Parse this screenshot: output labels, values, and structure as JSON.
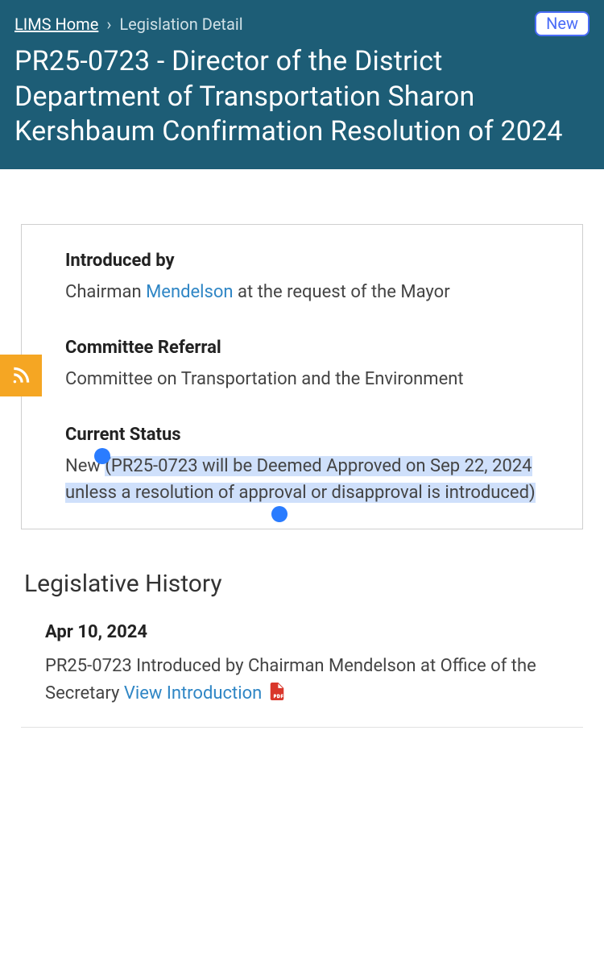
{
  "header": {
    "breadcrumb_home": "LIMS Home",
    "breadcrumb_current": "Legislation Detail",
    "new_badge": "New",
    "title": "PR25-0723 - Director of the District Department of Transportation Sharon Kershbaum Confirmation Resolution of 2024"
  },
  "info": {
    "introduced_label": "Introduced by",
    "introduced_prefix": "Chairman ",
    "introduced_link": "Mendelson",
    "introduced_suffix": " at the request of the Mayor",
    "referral_label": "Committee Referral",
    "referral_value": "Committee on Transportation and the Environment",
    "status_label": "Current Status",
    "status_prefix": "New ",
    "status_highlight": "(PR25-0723 will be Deemed Approved on Sep 22, 2024 unless a resolution of approval or disapproval is introduced)"
  },
  "history": {
    "section_title": "Legislative History",
    "item_date": "Apr 10, 2024",
    "item_text": "PR25-0723 Introduced by Chairman Mendelson at Office of the Secretary ",
    "item_link": "View Introduction"
  },
  "icons": {
    "rss": "rss-icon",
    "pdf": "pdf-icon"
  }
}
